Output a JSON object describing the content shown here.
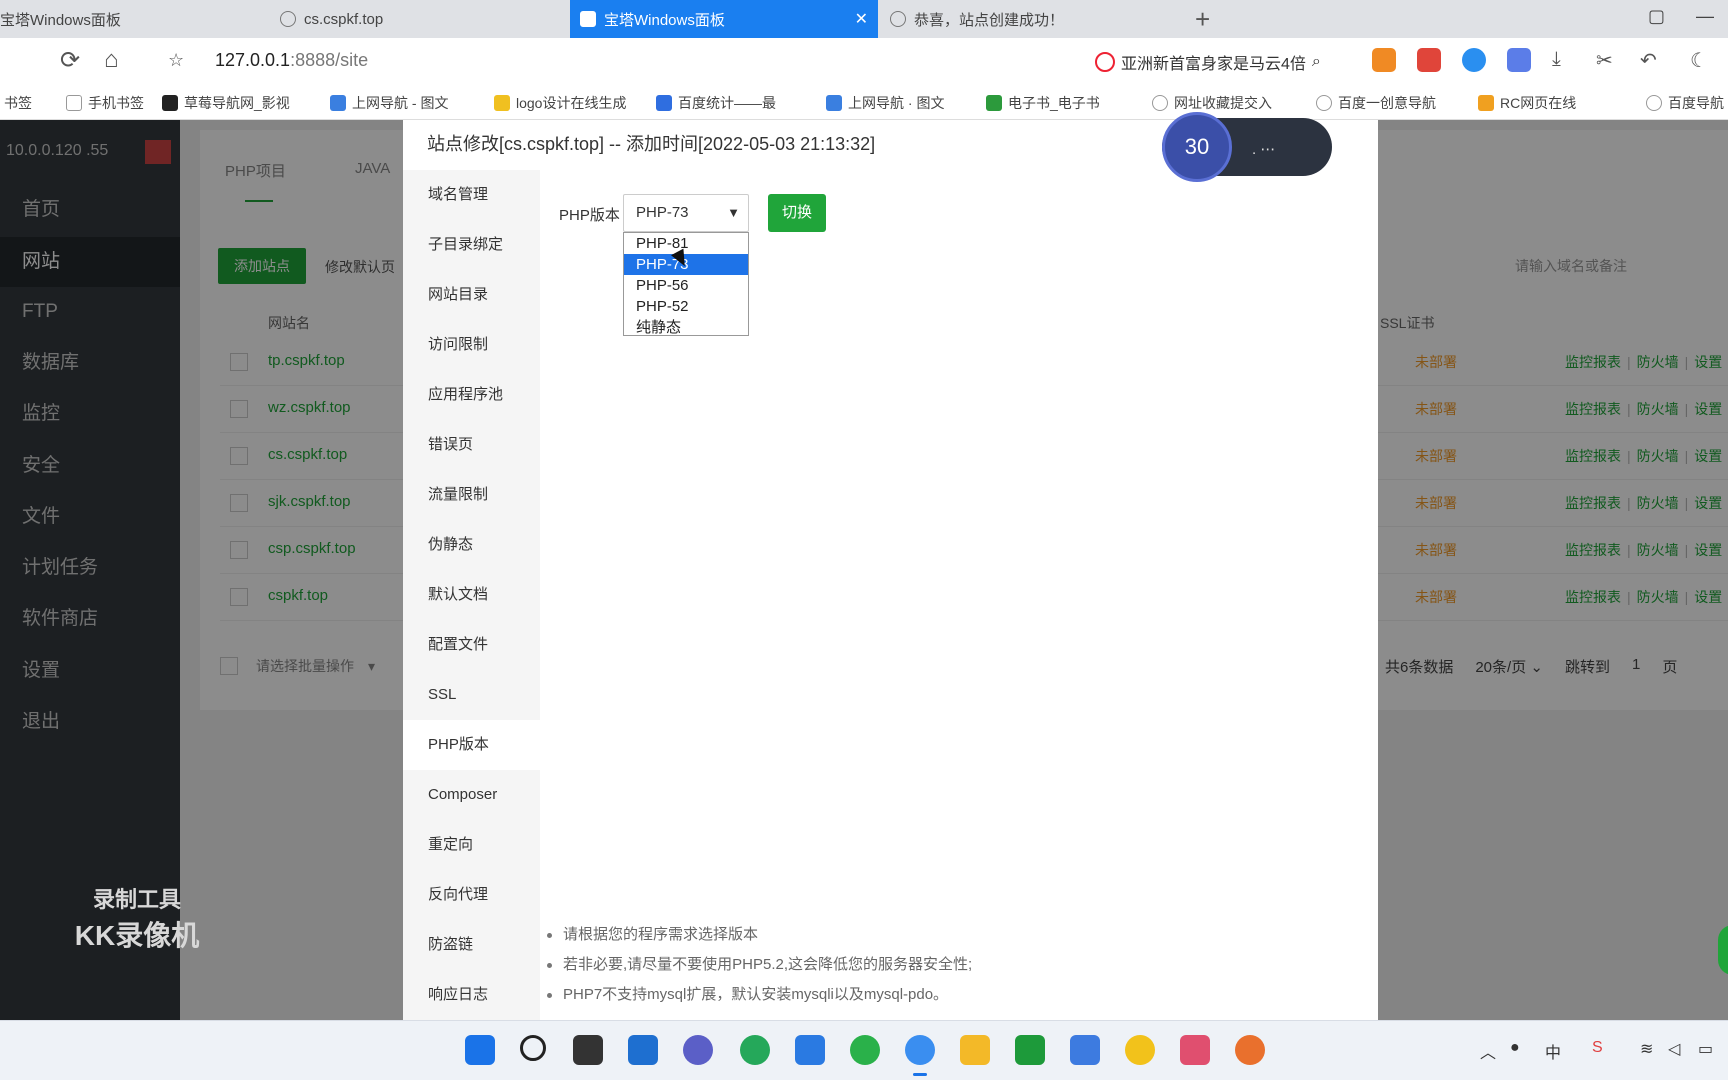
{
  "browser": {
    "tabs": [
      {
        "label": "宝塔Windows面板"
      },
      {
        "label": "cs.cspkf.top"
      },
      {
        "label": "宝塔Windows面板",
        "active": true
      },
      {
        "label": "恭喜，站点创建成功！"
      }
    ],
    "new_tab": "+",
    "url_host": "127.0.0.1",
    "url_rest": ":8888/site",
    "search_hint": "亚洲新首富身家是马云4倍",
    "bookmarks": [
      "书签",
      "手机书签",
      "草莓导航网_影视",
      "上网导航 - 图文",
      "logo设计在线生成",
      "百度统计——最",
      "上网导航 · 图文",
      "电子书_电子书",
      "网址收藏提交入",
      "百度一创意导航",
      "RC网页在线",
      "百度导航"
    ]
  },
  "app": {
    "sidebar": {
      "ip": "10.0.0.120 .55",
      "items": [
        {
          "label": "首页"
        },
        {
          "label": "网站",
          "active": true
        },
        {
          "label": "FTP"
        },
        {
          "label": "数据库"
        },
        {
          "label": "监控"
        },
        {
          "label": "安全"
        },
        {
          "label": "文件"
        },
        {
          "label": "计划任务"
        },
        {
          "label": "软件商店"
        },
        {
          "label": "设置"
        },
        {
          "label": "退出"
        }
      ]
    },
    "toolbar": {
      "tab_site": "PHP项目",
      "tab_other": "JAVA",
      "add_label": "添加站点",
      "default_label": "修改默认页"
    },
    "hint_right": "请输入域名或备注",
    "columns": {
      "site": "网站名",
      "ssl": "SSL证书"
    },
    "rows": [
      {
        "site": "tp.cspkf.top",
        "status": "未部署",
        "monitor": "监控报表",
        "firewall": "防火墙",
        "settings": "设置"
      },
      {
        "site": "wz.cspkf.top",
        "status": "未部署",
        "monitor": "监控报表",
        "firewall": "防火墙",
        "settings": "设置"
      },
      {
        "site": "cs.cspkf.top",
        "status": "未部署",
        "monitor": "监控报表",
        "firewall": "防火墙",
        "settings": "设置"
      },
      {
        "site": "sjk.cspkf.top",
        "status": "未部署",
        "monitor": "监控报表",
        "firewall": "防火墙",
        "settings": "设置"
      },
      {
        "site": "csp.cspkf.top",
        "status": "未部署",
        "monitor": "监控报表",
        "firewall": "防火墙",
        "settings": "设置"
      },
      {
        "site": "cspkf.top",
        "status": "未部署",
        "monitor": "监控报表",
        "firewall": "防火墙",
        "settings": "设置"
      }
    ],
    "batch_placeholder": "请选择批量操作",
    "pager": {
      "total": "共6条数据",
      "per_page": "20条/页",
      "jump": "跳转到",
      "page": "1",
      "page_unit": "页"
    }
  },
  "dialog": {
    "title": "站点修改[cs.cspkf.top] -- 添加时间[2022-05-03 21:13:32]",
    "menu": [
      {
        "label": "域名管理"
      },
      {
        "label": "子目录绑定"
      },
      {
        "label": "网站目录"
      },
      {
        "label": "访问限制"
      },
      {
        "label": "应用程序池"
      },
      {
        "label": "错误页"
      },
      {
        "label": "流量限制"
      },
      {
        "label": "伪静态"
      },
      {
        "label": "默认文档"
      },
      {
        "label": "配置文件"
      },
      {
        "label": "SSL"
      },
      {
        "label": "PHP版本",
        "active": true
      },
      {
        "label": "Composer"
      },
      {
        "label": "重定向"
      },
      {
        "label": "反向代理"
      },
      {
        "label": "防盗链"
      },
      {
        "label": "响应日志"
      }
    ],
    "php_label": "PHP版本",
    "php_selected": "PHP-73",
    "switch_label": "切换",
    "options": [
      "PHP-81",
      "PHP-73",
      "PHP-56",
      "PHP-52",
      "纯静态"
    ],
    "highlighted_option": 1,
    "notes": [
      "请根据您的程序需求选择版本",
      "若非必要,请尽量不要使用PHP5.2,这会降低您的服务器安全性;",
      "PHP7不支持mysql扩展，默认安装mysqli以及mysql-pdo。"
    ]
  },
  "recorder": {
    "timer": "30",
    "watermark_line1": "录制工具",
    "watermark_line2": "KK录像机"
  },
  "colors": {
    "accent": "#20a53a",
    "selection": "#1e73e8",
    "active_tab": "#1a7ff0"
  }
}
